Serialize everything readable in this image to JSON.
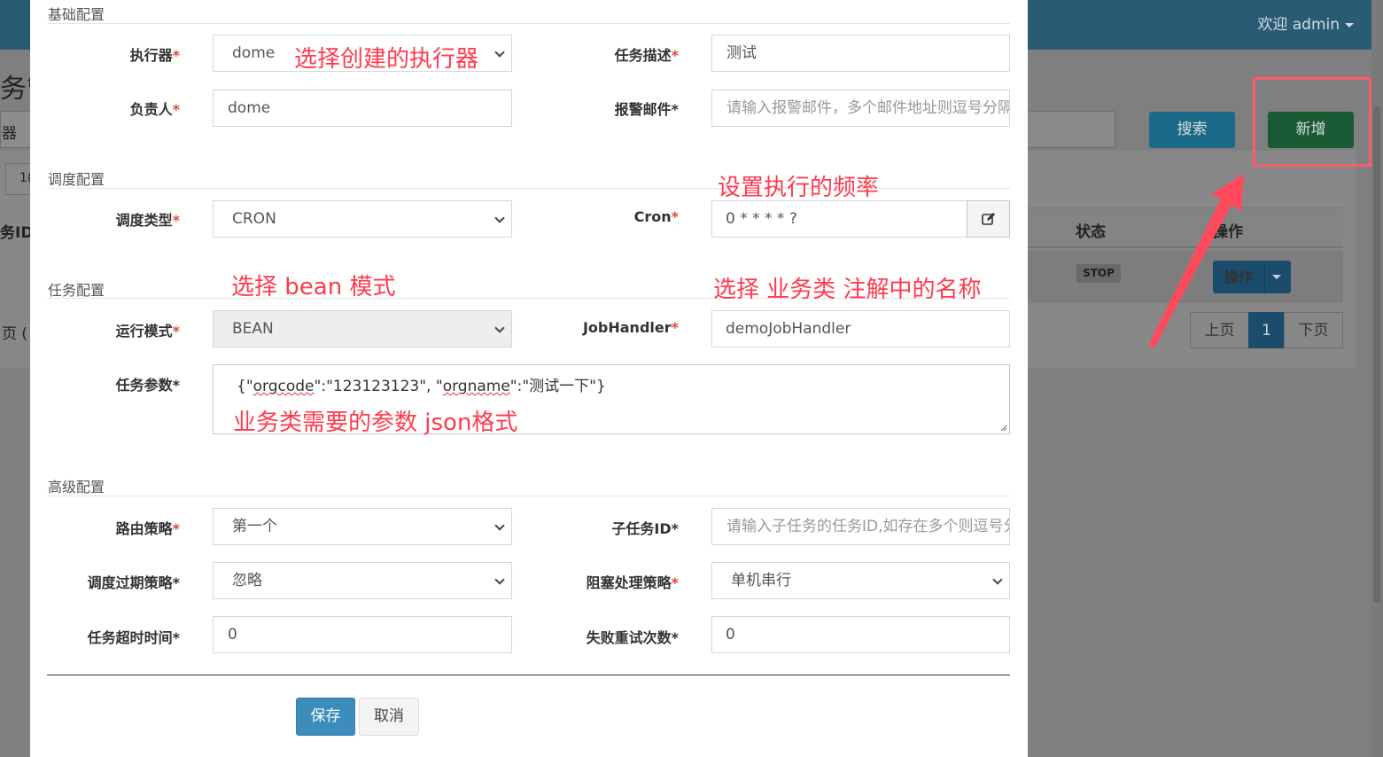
{
  "background": {
    "user_menu": "欢迎 admin",
    "title_fragment": "务管",
    "left_fragment_1": "器",
    "left_fragment_2": "1(",
    "left_col_id": "务ID",
    "left_page_fragment": "页 (",
    "search_label": "搜索",
    "add_label": "新增",
    "table_headers": [
      "状态",
      "操作"
    ],
    "row_status": "STOP",
    "row_action": "操作",
    "pagination": {
      "prev": "上页",
      "current": "1",
      "next": "下页"
    },
    "colors": {
      "topbar": "#2a5b74",
      "search": "#1a6a88",
      "add": "#1a5a35"
    }
  },
  "modal": {
    "sections": {
      "basic": "基础配置",
      "schedule": "调度配置",
      "task": "任务配置",
      "advanced": "高级配置"
    },
    "fields": {
      "executor": {
        "label": "执行器",
        "value": "dome"
      },
      "description": {
        "label": "任务描述",
        "value": "测试"
      },
      "owner": {
        "label": "负责人",
        "value": "dome"
      },
      "alarm_email": {
        "label": "报警邮件",
        "placeholder": "请输入报警邮件，多个邮件地址则逗号分隔"
      },
      "schedule_type": {
        "label": "调度类型",
        "value": "CRON"
      },
      "cron": {
        "label": "Cron",
        "value": "0 * * * * ?"
      },
      "run_mode": {
        "label": "运行模式",
        "value": "BEAN"
      },
      "job_handler": {
        "label": "JobHandler",
        "value": "demoJobHandler"
      },
      "task_params": {
        "label": "任务参数",
        "value_parts": [
          "{\"",
          "orgcode",
          "\":\"123123123\", \"",
          "orgname",
          "\":\"测试一下\"}"
        ]
      },
      "route_strategy": {
        "label": "路由策略",
        "value": "第一个"
      },
      "child_job_id": {
        "label": "子任务ID",
        "placeholder": "请输入子任务的任务ID,如存在多个则逗号分隔"
      },
      "misfire_strategy": {
        "label": "调度过期策略",
        "value": "忽略"
      },
      "block_strategy": {
        "label": "阻塞处理策略",
        "value": "单机串行"
      },
      "timeout": {
        "label": "任务超时时间",
        "value": "0"
      },
      "retry_count": {
        "label": "失败重试次数",
        "value": "0"
      }
    },
    "required_mark": "*",
    "buttons": {
      "save": "保存",
      "cancel": "取消"
    },
    "colors": {
      "primary": "#3c8dbc",
      "required": "#dd4b39"
    }
  },
  "annotations": {
    "executor_note": "选择创建的执行器",
    "cron_note": "设置执行的频率",
    "bean_note": "选择 bean 模式",
    "handler_note": "选择 业务类 注解中的名称",
    "params_note": "业务类需要的参数  json格式",
    "color": "#ff3b4e"
  }
}
